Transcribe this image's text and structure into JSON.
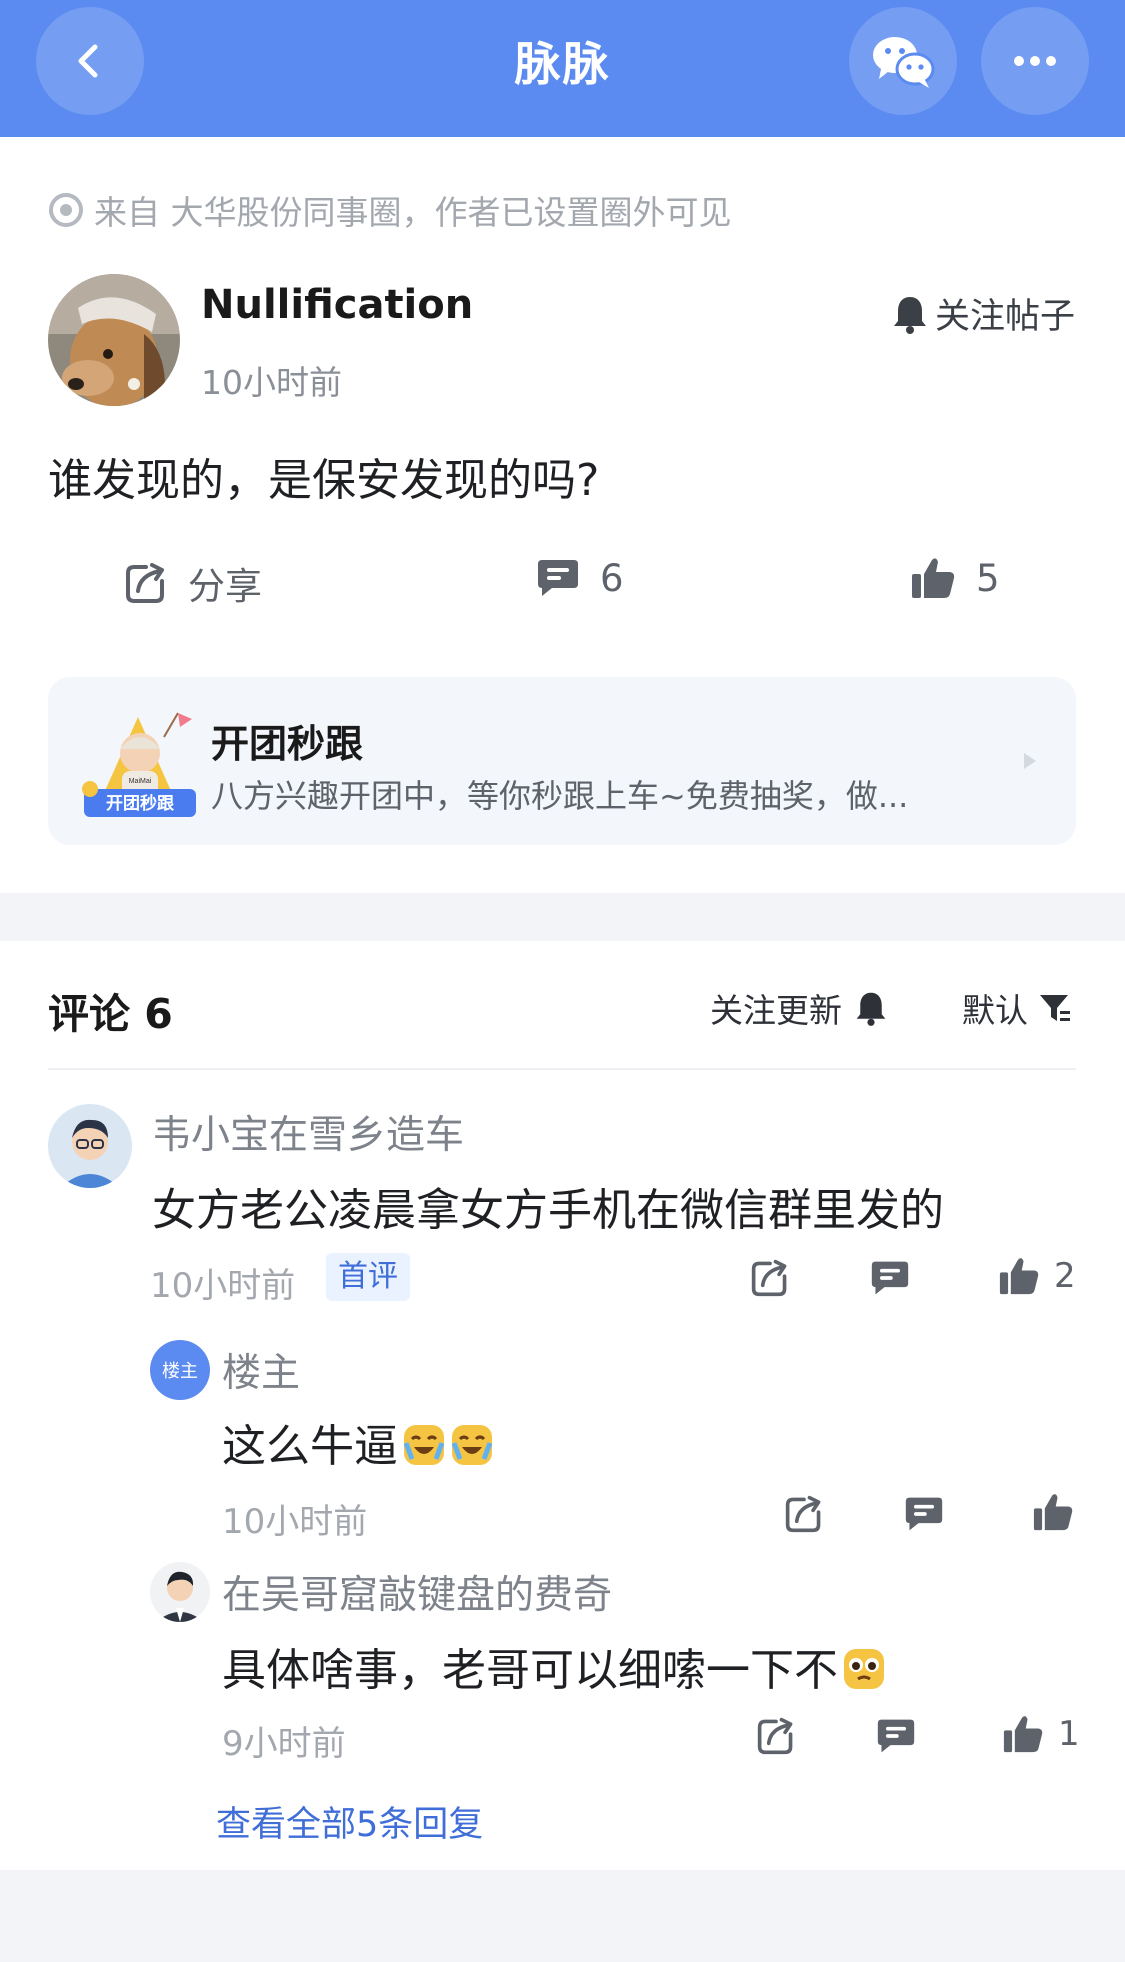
{
  "header": {
    "title": "脉脉",
    "accent": "#5b8bf0",
    "back_icon": "chevron-left-icon",
    "share_icon": "wechat-icon",
    "more_icon": "more-dots-icon"
  },
  "post": {
    "source": "来自 大华股份同事圈，作者已设置圈外可见",
    "author": "Nullification",
    "time": "10小时前",
    "follow_label": "关注帖子",
    "text": "谁发现的，是保安发现的吗?",
    "actions": {
      "share_label": "分享",
      "comment_count": "6",
      "like_count": "5"
    }
  },
  "promo": {
    "title": "开团秒跟",
    "description": "八方兴趣开团中，等你秒跟上车~免费抽奖，做...",
    "badge_text": "开团秒跟",
    "badge_brand": "MaiMai"
  },
  "comments_header": {
    "title": "评论 6",
    "follow_updates": "关注更新",
    "sort": "默认"
  },
  "comments": [
    {
      "name": "韦小宝在雪乡造车",
      "text": "女方老公凌晨拿女方手机在微信群里发的",
      "time": "10小时前",
      "badge": "首评",
      "likes": "2"
    },
    {
      "avatar_text": "楼主",
      "name": "楼主",
      "text": "这么牛逼",
      "time": "10小时前",
      "likes": ""
    },
    {
      "name": "在吴哥窟敲键盘的费奇",
      "text": "具体啥事，老哥可以细嗦一下不",
      "time": "9小时前",
      "likes": "1"
    }
  ],
  "view_all": "查看全部5条回复"
}
